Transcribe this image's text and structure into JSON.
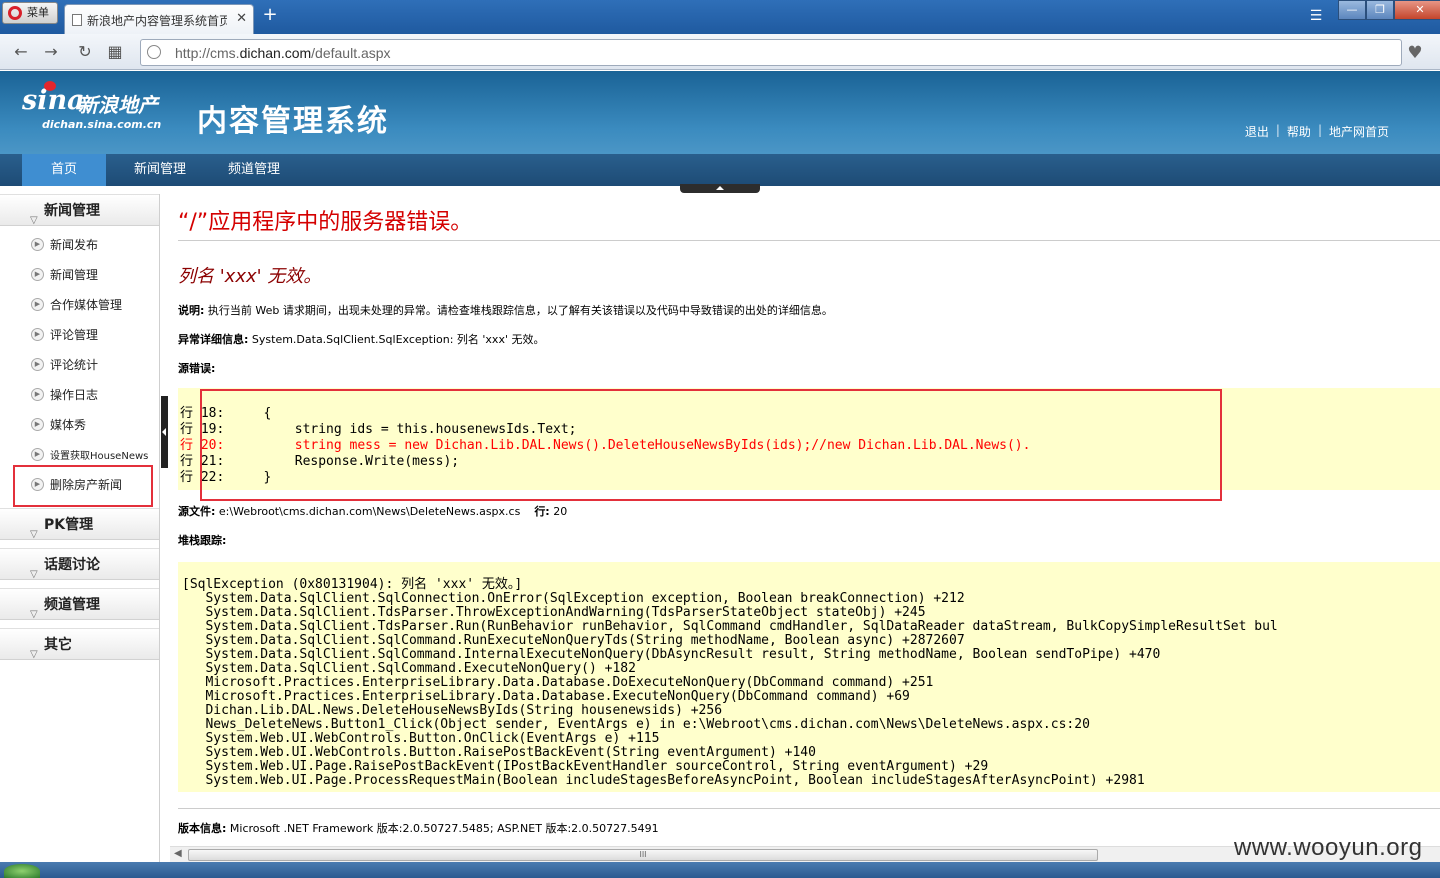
{
  "browser": {
    "menu_label": "菜单",
    "tab_title": "新浪地产内容管理系统首页",
    "tab_close": "✕",
    "new_tab": "+",
    "url_host_prefix": "http://cms.",
    "url_host": "dichan.com",
    "url_path": "/default.aspx",
    "back": "←",
    "forward": "→",
    "reload": "↻",
    "speed_dial": "▦",
    "tab_menu": "☰",
    "favorite": "♥",
    "minimize": "—",
    "maximize": "❐",
    "close": "✕"
  },
  "header": {
    "logo_sina": "sina",
    "logo_cn": "新浪地产",
    "logo_domain": "dichan.sina.com.cn",
    "system_title": "内容管理系统",
    "links": [
      "退出",
      "帮助",
      "地产网首页"
    ],
    "separator": "|"
  },
  "nav": {
    "items": [
      "首页",
      "新闻管理",
      "频道管理"
    ],
    "active": "首页"
  },
  "sidebar": {
    "groups": [
      {
        "title": "新闻管理",
        "items": [
          "新闻发布",
          "新闻管理",
          "合作媒体管理",
          "评论管理",
          "评论统计",
          "操作日志",
          "媒体秀",
          "设置获取HouseNews",
          "删除房产新闻"
        ]
      },
      {
        "title": "PK管理",
        "items": []
      },
      {
        "title": "话题讨论",
        "items": []
      },
      {
        "title": "频道管理",
        "items": []
      },
      {
        "title": "其它",
        "items": []
      }
    ]
  },
  "error": {
    "title": "“/”应用程序中的服务器错误。",
    "subtitle": "列名 'xxx' 无效。",
    "description_label": "说明:",
    "description": " 执行当前 Web 请求期间，出现未处理的异常。请检查堆栈跟踪信息，以了解有关该错误以及代码中导致错误的出处的详细信息。",
    "exception_label": "异常详细信息:",
    "exception": " System.Data.SqlClient.SqlException: 列名 'xxx' 无效。",
    "source_error_label": "源错误:",
    "source_lines": [
      "行 18:     {",
      "行 19:         string ids = this.housenewsIds.Text;",
      "行 20:         string mess = new Dichan.Lib.DAL.News().DeleteHouseNewsByIds(ids);//new Dichan.Lib.DAL.News().",
      "行 21:         Response.Write(mess);",
      "行 22:     }"
    ],
    "error_line_index": 2,
    "source_file_label": "源文件:",
    "source_file": " e:\\Webroot\\cms.dichan.com\\News\\DeleteNews.aspx.cs",
    "line_label": "行:",
    "line_number": " 20",
    "stack_label": "堆栈跟踪:",
    "stack_lines": [
      "[SqlException (0x80131904): 列名 'xxx' 无效。]",
      "   System.Data.SqlClient.SqlConnection.OnError(SqlException exception, Boolean breakConnection) +212",
      "   System.Data.SqlClient.TdsParser.ThrowExceptionAndWarning(TdsParserStateObject stateObj) +245",
      "   System.Data.SqlClient.TdsParser.Run(RunBehavior runBehavior, SqlCommand cmdHandler, SqlDataReader dataStream, BulkCopySimpleResultSet bul",
      "   System.Data.SqlClient.SqlCommand.RunExecuteNonQueryTds(String methodName, Boolean async) +2872607",
      "   System.Data.SqlClient.SqlCommand.InternalExecuteNonQuery(DbAsyncResult result, String methodName, Boolean sendToPipe) +470",
      "   System.Data.SqlClient.SqlCommand.ExecuteNonQuery() +182",
      "   Microsoft.Practices.EnterpriseLibrary.Data.Database.DoExecuteNonQuery(DbCommand command) +251",
      "   Microsoft.Practices.EnterpriseLibrary.Data.Database.ExecuteNonQuery(DbCommand command) +69",
      "   Dichan.Lib.DAL.News.DeleteHouseNewsByIds(String housenewsids) +256",
      "   News_DeleteNews.Button1_Click(Object sender, EventArgs e) in e:\\Webroot\\cms.dichan.com\\News\\DeleteNews.aspx.cs:20",
      "   System.Web.UI.WebControls.Button.OnClick(EventArgs e) +115",
      "   System.Web.UI.WebControls.Button.RaisePostBackEvent(String eventArgument) +140",
      "   System.Web.UI.Page.RaisePostBackEvent(IPostBackEventHandler sourceControl, String eventArgument) +29",
      "   System.Web.UI.Page.ProcessRequestMain(Boolean includeStagesBeforeAsyncPoint, Boolean includeStagesAfterAsyncPoint) +2981"
    ],
    "version_label": "版本信息:",
    "version": " Microsoft .NET Framework 版本:2.0.50727.5485; ASP.NET 版本:2.0.50727.5491"
  },
  "scrollbar_grip": "III",
  "watermark": "www.wooyun.org",
  "colors": {
    "header_blue": "#2f7fb4",
    "nav_active": "#3f8ed1",
    "error_red": "#d40000",
    "code_bg": "#ffffcc",
    "highlight_box": "#e3303b"
  }
}
